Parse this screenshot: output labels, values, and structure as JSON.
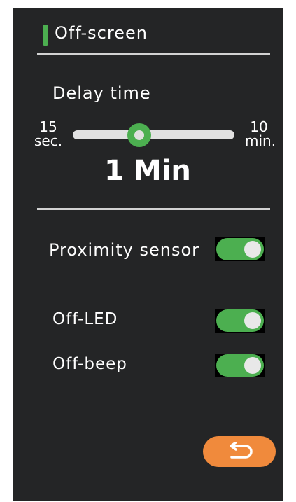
{
  "header": {
    "title": "Off-screen",
    "accent_color": "#4caf50"
  },
  "delay": {
    "label": "Delay time",
    "min_value_line1": "15",
    "min_value_line2": "sec.",
    "max_value_line1": "10",
    "max_value_line2": "min.",
    "current_value": "1 Min",
    "slider_position_fraction": 0.41
  },
  "settings": {
    "proximity_sensor": {
      "label": "Proximity sensor",
      "enabled": true
    },
    "off_led": {
      "label": "Off-LED",
      "enabled": true
    },
    "off_beep": {
      "label": "Off-beep",
      "enabled": true
    }
  },
  "back_button": {
    "icon": "return-arrow-icon",
    "color": "#f08a3c"
  },
  "colors": {
    "background": "#242526",
    "toggle_on": "#4caf50",
    "divider": "#d2d2d2"
  }
}
